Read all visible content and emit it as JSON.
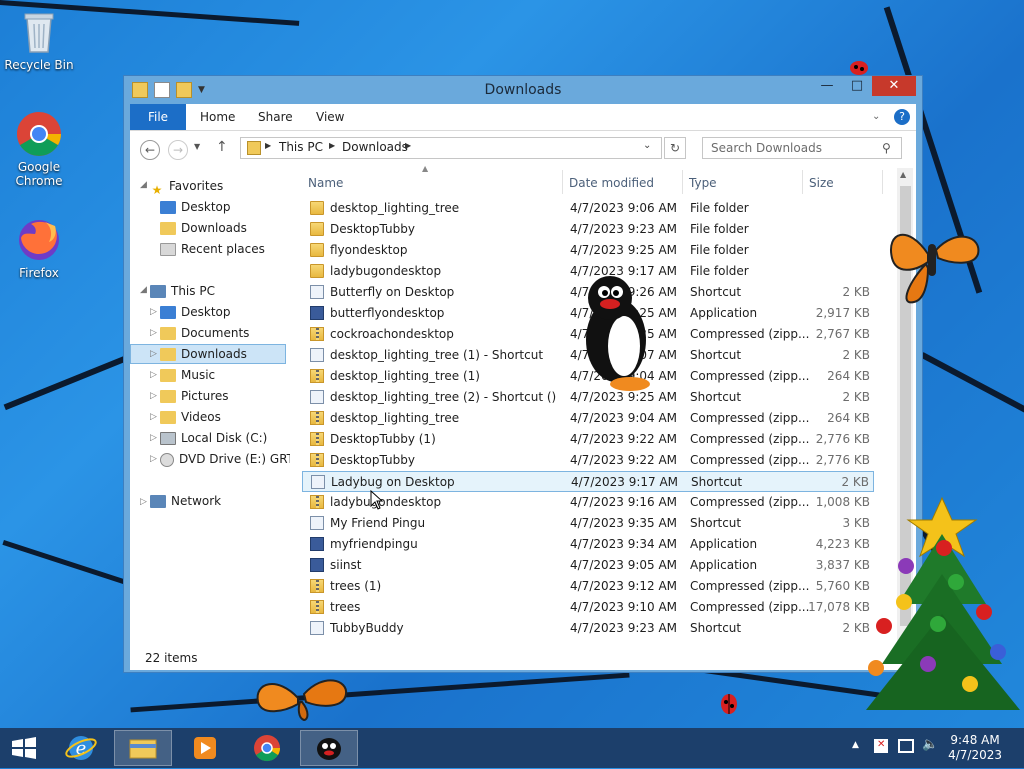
{
  "desktop": {
    "icons": [
      {
        "label": "Recycle Bin"
      },
      {
        "label": "Google\nChrome"
      },
      {
        "label": "Firefox"
      }
    ]
  },
  "window": {
    "title": "Downloads",
    "tabs": {
      "file": "File",
      "home": "Home",
      "share": "Share",
      "view": "View"
    },
    "breadcrumb": [
      "This PC",
      "Downloads"
    ],
    "search_placeholder": "Search Downloads",
    "status": "22 items"
  },
  "nav": {
    "favorites": "Favorites",
    "fav_items": [
      "Desktop",
      "Downloads",
      "Recent places"
    ],
    "this_pc": "This PC",
    "pc_items": [
      "Desktop",
      "Documents",
      "Downloads",
      "Music",
      "Pictures",
      "Videos",
      "Local Disk (C:)",
      "DVD Drive (E:) GRTM"
    ],
    "network": "Network"
  },
  "columns": {
    "name": "Name",
    "date": "Date modified",
    "type": "Type",
    "size": "Size"
  },
  "files": [
    {
      "name": "desktop_lighting_tree",
      "date": "4/7/2023 9:06 AM",
      "type": "File folder",
      "size": "",
      "icon": "folder-icon"
    },
    {
      "name": "DesktopTubby",
      "date": "4/7/2023 9:23 AM",
      "type": "File folder",
      "size": "",
      "icon": "folder-icon"
    },
    {
      "name": "flyondesktop",
      "date": "4/7/2023 9:25 AM",
      "type": "File folder",
      "size": "",
      "icon": "folder-icon"
    },
    {
      "name": "ladybugondesktop",
      "date": "4/7/2023 9:17 AM",
      "type": "File folder",
      "size": "",
      "icon": "folder-icon"
    },
    {
      "name": "Butterfly on Desktop",
      "date": "4/7/2023 9:26 AM",
      "type": "Shortcut",
      "size": "2 KB",
      "icon": "shortcut-icon"
    },
    {
      "name": "butterflyondesktop",
      "date": "4/7/2023 9:25 AM",
      "type": "Application",
      "size": "2,917 KB",
      "icon": "application-icon"
    },
    {
      "name": "cockroachondesktop",
      "date": "4/7/2023 9:25 AM",
      "type": "Compressed (zipp...",
      "size": "2,767 KB",
      "icon": "zip-icon"
    },
    {
      "name": "desktop_lighting_tree (1) - Shortcut",
      "date": "4/7/2023 9:07 AM",
      "type": "Shortcut",
      "size": "2 KB",
      "icon": "shortcut-icon"
    },
    {
      "name": "desktop_lighting_tree (1)",
      "date": "4/7/2023 9:04 AM",
      "type": "Compressed (zipp...",
      "size": "264 KB",
      "icon": "zip-icon"
    },
    {
      "name": "desktop_lighting_tree (2) - Shortcut ()",
      "date": "4/7/2023 9:25 AM",
      "type": "Shortcut",
      "size": "2 KB",
      "icon": "shortcut-icon"
    },
    {
      "name": "desktop_lighting_tree",
      "date": "4/7/2023 9:04 AM",
      "type": "Compressed (zipp...",
      "size": "264 KB",
      "icon": "zip-icon"
    },
    {
      "name": "DesktopTubby (1)",
      "date": "4/7/2023 9:22 AM",
      "type": "Compressed (zipp...",
      "size": "2,776 KB",
      "icon": "zip-icon"
    },
    {
      "name": "DesktopTubby",
      "date": "4/7/2023 9:22 AM",
      "type": "Compressed (zipp...",
      "size": "2,776 KB",
      "icon": "zip-icon"
    },
    {
      "name": "Ladybug on Desktop",
      "date": "4/7/2023 9:17 AM",
      "type": "Shortcut",
      "size": "2 KB",
      "icon": "shortcut-icon",
      "selected": true
    },
    {
      "name": "ladybugondesktop",
      "date": "4/7/2023 9:16 AM",
      "type": "Compressed (zipp...",
      "size": "1,008 KB",
      "icon": "zip-icon"
    },
    {
      "name": "My Friend Pingu",
      "date": "4/7/2023 9:35 AM",
      "type": "Shortcut",
      "size": "3 KB",
      "icon": "shortcut-icon"
    },
    {
      "name": "myfriendpingu",
      "date": "4/7/2023 9:34 AM",
      "type": "Application",
      "size": "4,223 KB",
      "icon": "application-icon"
    },
    {
      "name": "siinst",
      "date": "4/7/2023 9:05 AM",
      "type": "Application",
      "size": "3,837 KB",
      "icon": "application-icon"
    },
    {
      "name": "trees (1)",
      "date": "4/7/2023 9:12 AM",
      "type": "Compressed (zipp...",
      "size": "5,760 KB",
      "icon": "zip-icon"
    },
    {
      "name": "trees",
      "date": "4/7/2023 9:10 AM",
      "type": "Compressed (zipp...",
      "size": "17,078 KB",
      "icon": "zip-icon"
    },
    {
      "name": "TubbyBuddy",
      "date": "4/7/2023 9:23 AM",
      "type": "Shortcut",
      "size": "2 KB",
      "icon": "shortcut-icon"
    }
  ],
  "taskbar": {
    "time": "9:48 AM",
    "date": "4/7/2023",
    "apps": [
      "start-icon",
      "internet-explorer-icon",
      "file-explorer-icon",
      "media-player-icon",
      "chrome-icon",
      "pingu-icon"
    ]
  }
}
